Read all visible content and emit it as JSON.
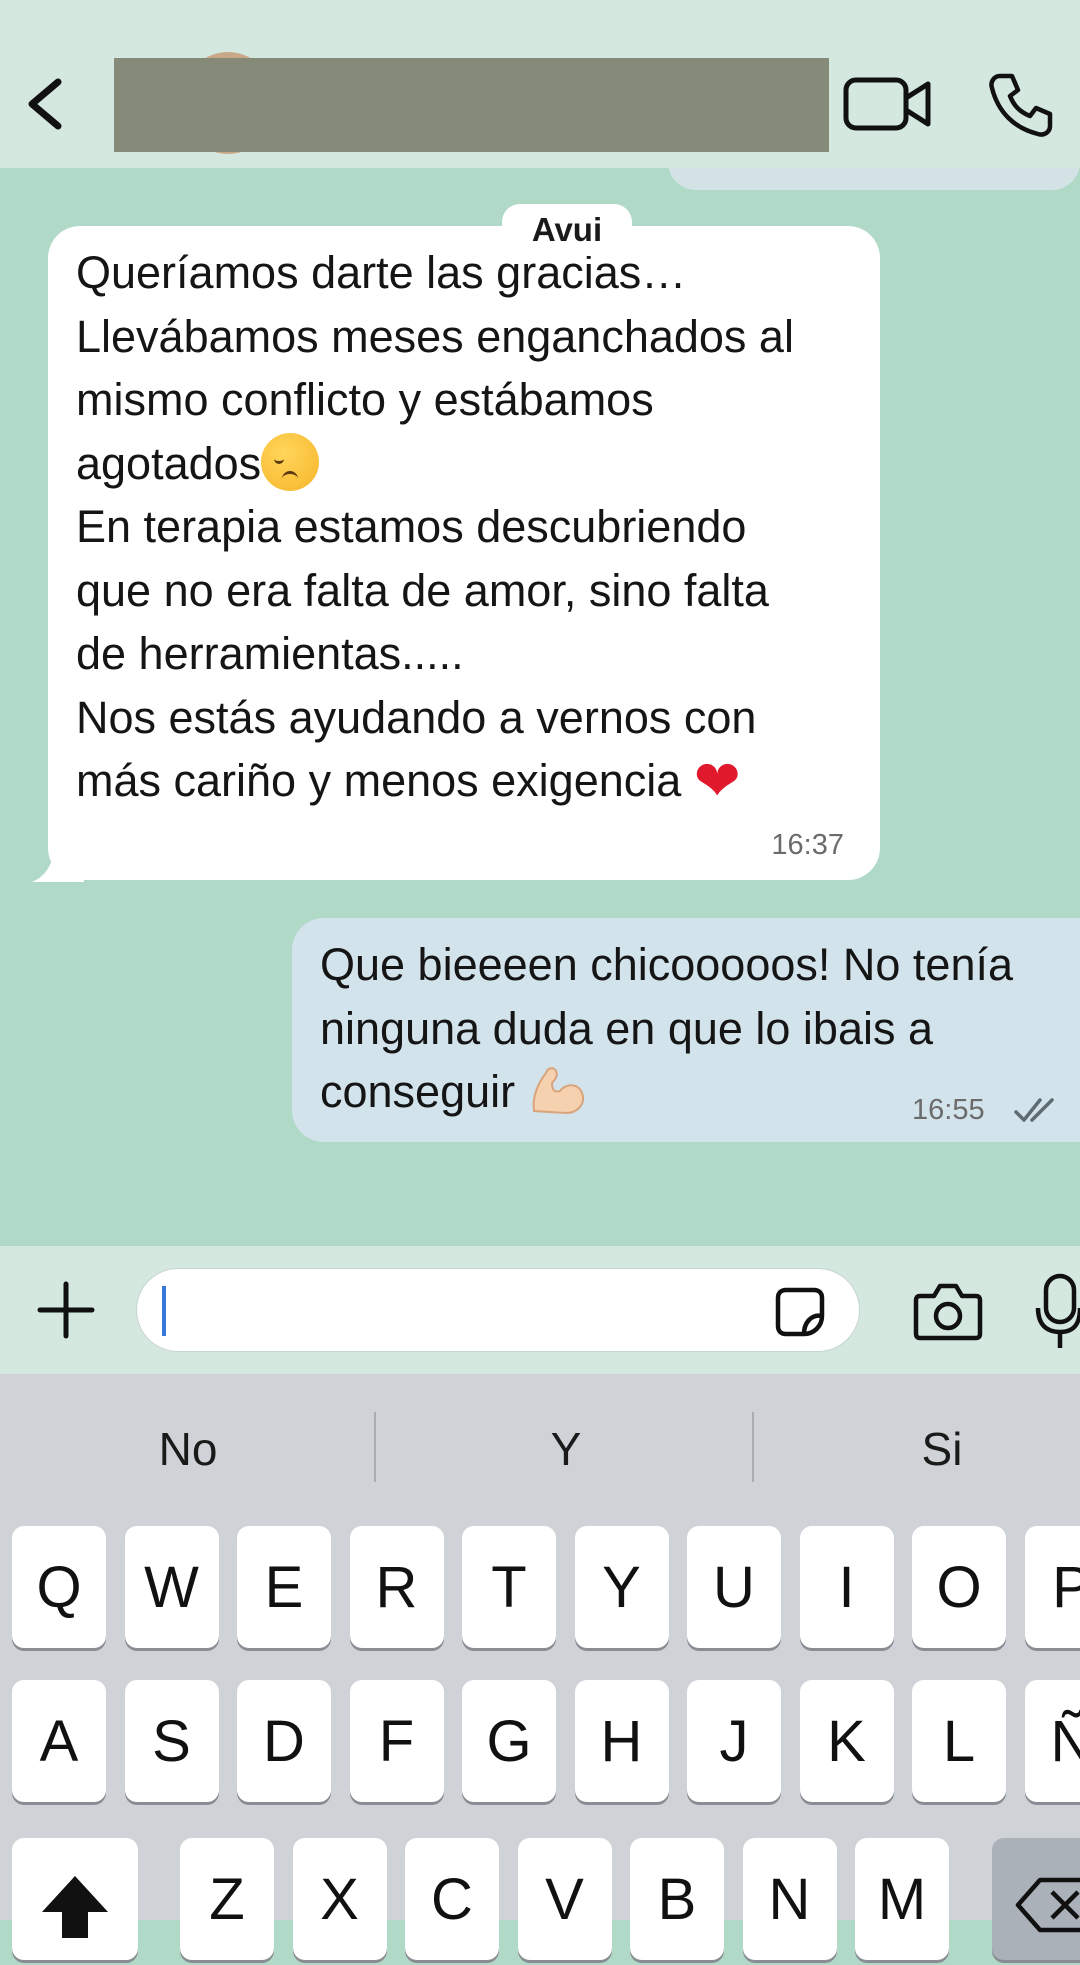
{
  "header": {
    "back_icon": "chevron-left-icon",
    "video_icon": "video-camera-icon",
    "phone_icon": "phone-icon"
  },
  "chat": {
    "date_label": "Avui",
    "messages": [
      {
        "direction": "incoming",
        "lines": [
          "Queríamos darte las gracias…",
          "Llevábamos meses enganchados al",
          "mismo conflicto y estábamos",
          "agotados",
          "En terapia estamos descubriendo",
          "que no era falta de amor, sino falta",
          "de herramientas.....",
          "Nos estás ayudando a vernos con",
          "más cariño y menos exigencia"
        ],
        "emojis": [
          "pensive-face",
          "red-heart"
        ],
        "time": "16:37"
      },
      {
        "direction": "outgoing",
        "lines": [
          "Que bieeeen chicooooos! No tenía",
          "ninguna duda en que lo ibais a",
          "conseguir"
        ],
        "emojis": [
          "flexed-biceps"
        ],
        "time": "16:55",
        "status": "read"
      }
    ]
  },
  "composer": {
    "value": "",
    "plus_icon": "plus-icon",
    "sticker_icon": "sticker-icon",
    "camera_icon": "camera-icon",
    "mic_icon": "microphone-icon"
  },
  "keyboard": {
    "suggestions": [
      "No",
      "Y",
      "Si"
    ],
    "row1": [
      "Q",
      "W",
      "E",
      "R",
      "T",
      "Y",
      "U",
      "I",
      "O",
      "P"
    ],
    "row2": [
      "A",
      "S",
      "D",
      "F",
      "G",
      "H",
      "J",
      "K",
      "L",
      "Ñ"
    ],
    "row3": [
      "Z",
      "X",
      "C",
      "V",
      "B",
      "N",
      "M"
    ],
    "shift_icon": "shift-arrow-icon",
    "delete_icon": "backspace-icon"
  },
  "colors": {
    "chat_background": "#b0dac7",
    "incoming_bubble": "#ffffff",
    "outgoing_bubble": "#d3e3ec",
    "header_background": "#d4e8e0",
    "keyboard_background": "#cfd3d8",
    "caret": "#3779d8"
  }
}
